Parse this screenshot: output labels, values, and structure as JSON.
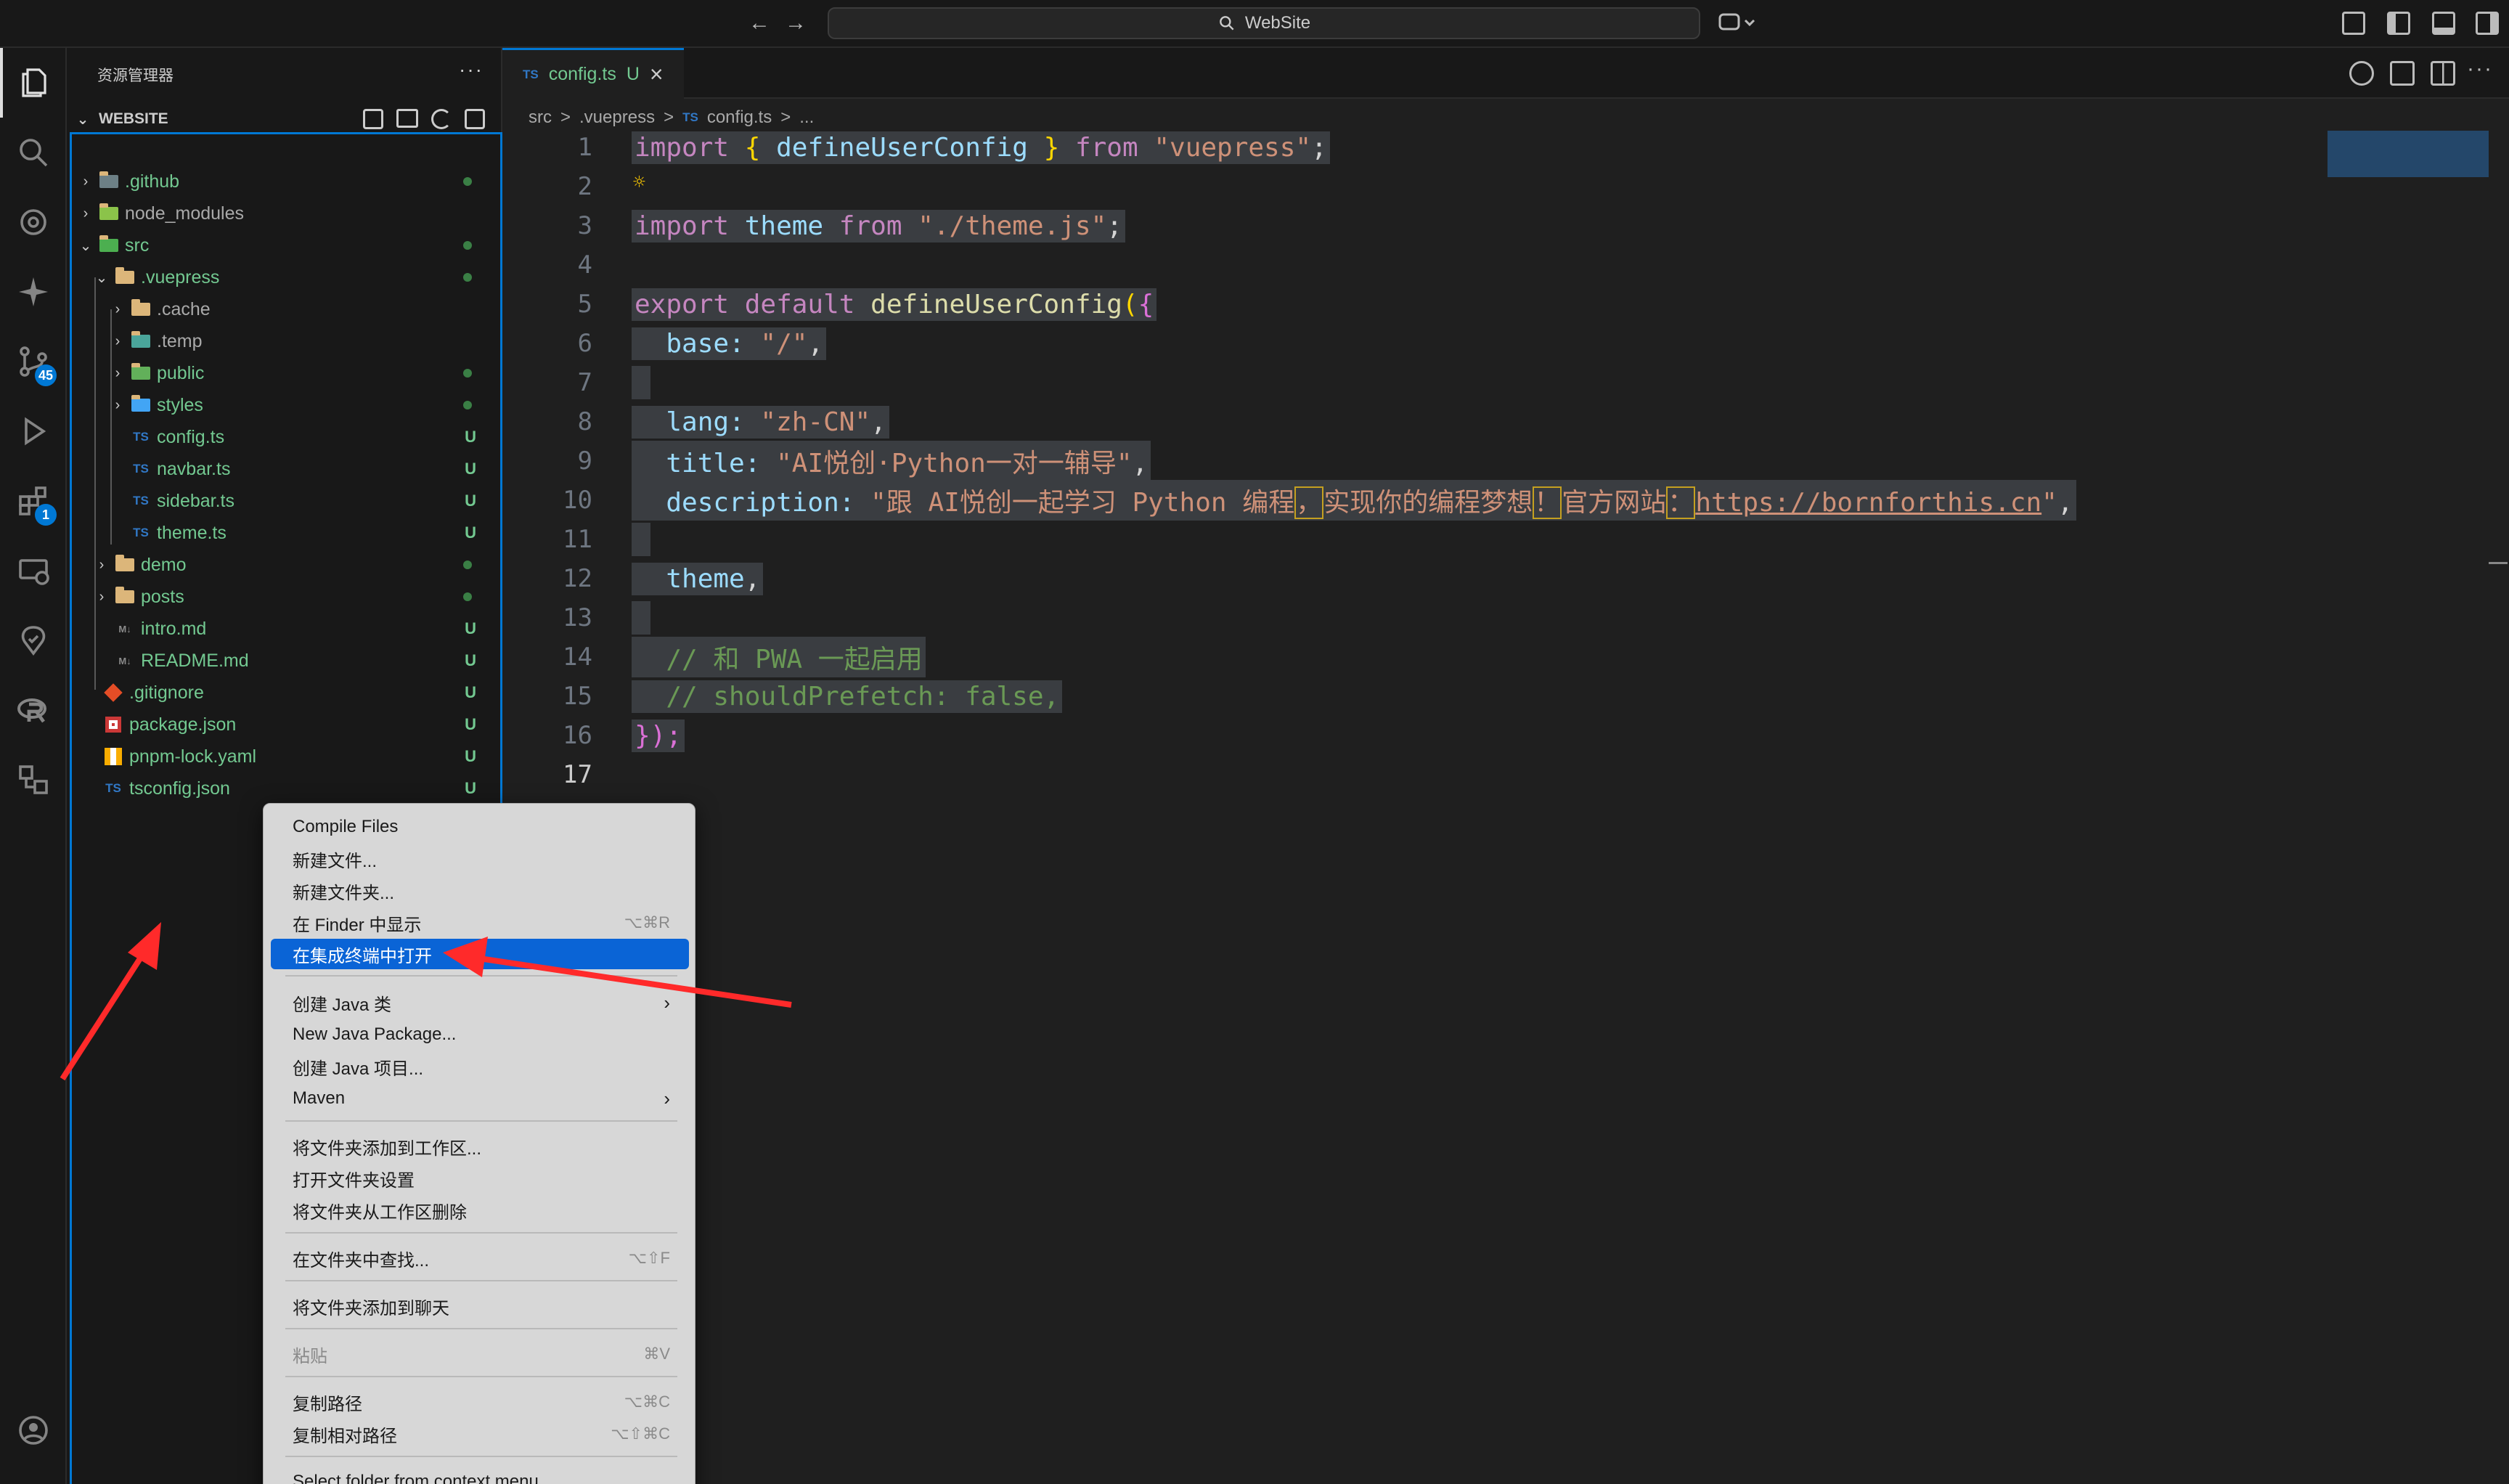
{
  "titlebar": {
    "search_text": "WebSite"
  },
  "activity": {
    "scm_badge": "45",
    "extensions_badge": "1"
  },
  "sidebar": {
    "title": "资源管理器",
    "more": "···",
    "section": "WEBSITE",
    "items": [
      {
        "label": ".github",
        "status": ""
      },
      {
        "label": "node_modules",
        "status": ""
      },
      {
        "label": "src",
        "status": ""
      },
      {
        "label": ".vuepress",
        "status": ""
      },
      {
        "label": ".cache",
        "status": ""
      },
      {
        "label": ".temp",
        "status": ""
      },
      {
        "label": "public",
        "status": ""
      },
      {
        "label": "styles",
        "status": ""
      },
      {
        "label": "config.ts",
        "status": "U"
      },
      {
        "label": "navbar.ts",
        "status": "U"
      },
      {
        "label": "sidebar.ts",
        "status": "U"
      },
      {
        "label": "theme.ts",
        "status": "U"
      },
      {
        "label": "demo",
        "status": ""
      },
      {
        "label": "posts",
        "status": ""
      },
      {
        "label": "intro.md",
        "status": "U"
      },
      {
        "label": "README.md",
        "status": "U"
      },
      {
        "label": ".gitignore",
        "status": "U"
      },
      {
        "label": "package.json",
        "status": "U"
      },
      {
        "label": "pnpm-lock.yaml",
        "status": "U"
      },
      {
        "label": "tsconfig.json",
        "status": "U"
      }
    ],
    "icon_text": {
      "ts": "TS",
      "md": "M↓"
    }
  },
  "editor": {
    "tab": {
      "label": "config.ts",
      "status": "U",
      "close": "×"
    },
    "breadcrumb": {
      "b1": "src",
      "b2": ".vuepress",
      "b3": "config.ts",
      "b4": "...",
      "sep": ">"
    },
    "line_numbers": [
      "1",
      "2",
      "3",
      "4",
      "5",
      "6",
      "7",
      "8",
      "9",
      "10",
      "11",
      "12",
      "13",
      "14",
      "15",
      "16",
      "17"
    ],
    "tokens": {
      "import": "import",
      "from": "from",
      "export": "export",
      "default": "default",
      "define": "defineUserConfig",
      "vuepress": "\"vuepress\"",
      "theme": "theme",
      "theme_path": "\"./theme.js\"",
      "semi": ";",
      "lb": "{",
      "rb": "}",
      "lp": "(",
      "end": "});",
      "base_key": "base:",
      "base_val": "\"/\"",
      "comma": ",",
      "lang_key": "lang:",
      "lang_val": "\"zh-CN\"",
      "title_key": "title:",
      "title_val": "\"AI悦创·Python一对一辅导\"",
      "desc_key": "description:",
      "desc_1": "\"跟 AI悦创一起学习 Python 编程",
      "desc_c1": "，",
      "desc_2": "实现你的编程梦想",
      "desc_c2": "！",
      "desc_3": "官方网站",
      "desc_c3": "：",
      "desc_url": "https://bornforthis.cn",
      "desc_end": "\"",
      "comment1": "// 和 PWA 一起启用",
      "comment2": "// shouldPrefetch: false,"
    }
  },
  "context_menu": {
    "items": [
      {
        "label": "Compile Files",
        "shortcut": ""
      },
      {
        "label": "新建文件...",
        "shortcut": ""
      },
      {
        "label": "新建文件夹...",
        "shortcut": ""
      },
      {
        "label": "在 Finder 中显示",
        "shortcut": "⌥⌘R"
      },
      {
        "label": "在集成终端中打开",
        "shortcut": ""
      },
      {
        "label": "创建 Java 类",
        "shortcut": ""
      },
      {
        "label": "New Java Package...",
        "shortcut": ""
      },
      {
        "label": "创建 Java 项目...",
        "shortcut": ""
      },
      {
        "label": "Maven",
        "shortcut": ""
      },
      {
        "label": "将文件夹添加到工作区...",
        "shortcut": ""
      },
      {
        "label": "打开文件夹设置",
        "shortcut": ""
      },
      {
        "label": "将文件夹从工作区删除",
        "shortcut": ""
      },
      {
        "label": "在文件夹中查找...",
        "shortcut": "⌥⇧F"
      },
      {
        "label": "将文件夹添加到聊天",
        "shortcut": ""
      },
      {
        "label": "粘贴",
        "shortcut": "⌘V"
      },
      {
        "label": "复制路径",
        "shortcut": "⌥⌘C"
      },
      {
        "label": "复制相对路径",
        "shortcut": "⌥⇧⌘C"
      },
      {
        "label": "Select folder from context menu",
        "shortcut": ""
      }
    ],
    "submenu_arrow": "›"
  },
  "colors": {
    "accent": "#0078d4",
    "untracked": "#73c991",
    "annotation_arrow": "#ff2a2a"
  }
}
